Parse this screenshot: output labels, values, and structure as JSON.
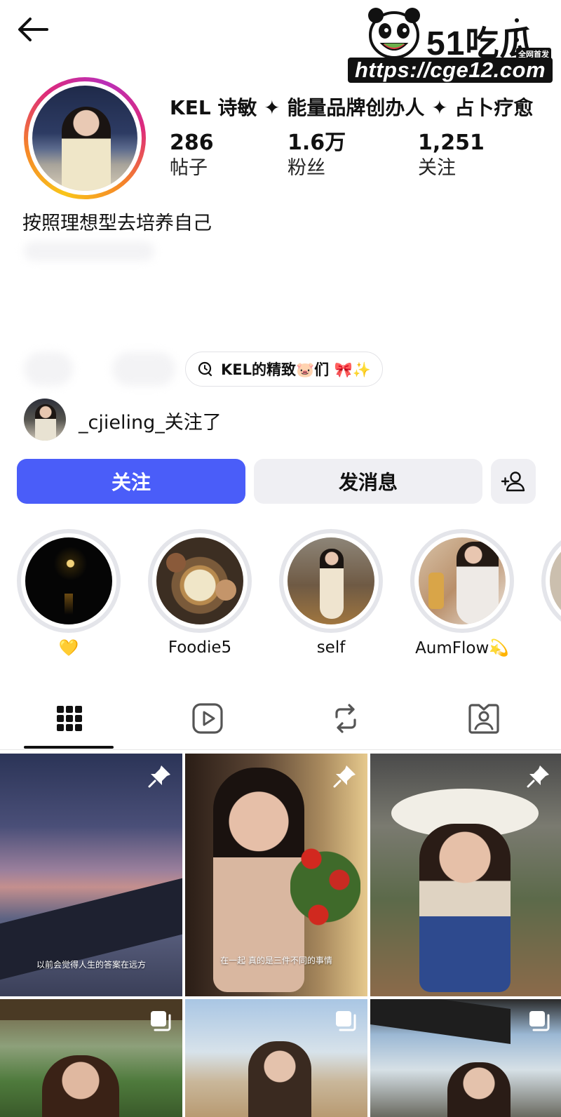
{
  "watermark": {
    "brand": "51吃瓜",
    "tag": "全网首发",
    "url": "https://cge12.com"
  },
  "profile": {
    "name": "KEL 诗敏 ✦ 能量品牌创办人 ✦ 占卜疗愈",
    "bio": "按照理想型去培养自己",
    "stats": [
      {
        "value": "286",
        "label": "帖子"
      },
      {
        "value": "1.6万",
        "label": "粉丝"
      },
      {
        "value": "1,251",
        "label": "关注"
      }
    ],
    "channel_chip": "KEL的精致🐷们 🎀✨",
    "followed_by": "_cjieling_关注了"
  },
  "actions": {
    "follow": "关注",
    "message": "发消息"
  },
  "highlights": [
    {
      "label": "💛"
    },
    {
      "label": "Foodie5"
    },
    {
      "label": "self"
    },
    {
      "label": "AumFlow💫"
    }
  ],
  "posts": [
    {
      "caption": "以前会觉得人生的答案在远方",
      "pinned": true
    },
    {
      "caption": "在一起 真的是三件不同的事情",
      "pinned": true
    },
    {
      "caption": "",
      "pinned": true
    },
    {
      "caption": "",
      "multi": true
    },
    {
      "caption": "",
      "multi": true
    },
    {
      "caption": "",
      "multi": true
    }
  ],
  "icons": {
    "back": "arrow-left-icon",
    "more": "more-vertical-icon",
    "add_friend": "person-add-icon",
    "tab_grid": "grid-icon",
    "tab_reels": "reels-icon",
    "tab_reposts": "repost-icon",
    "tab_tagged": "tagged-icon",
    "pin": "pin-icon",
    "multi": "carousel-icon",
    "threads": "threads-icon"
  },
  "colors": {
    "follow_button": "#4a5df9",
    "secondary_button": "#efeff3"
  }
}
